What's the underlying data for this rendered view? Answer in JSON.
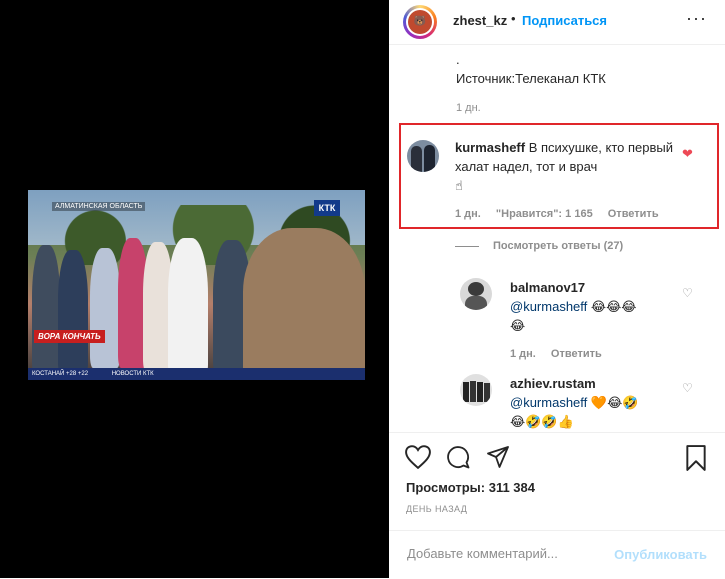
{
  "video": {
    "region_tag": "АЛМАТИНСКАЯ ОБЛАСТЬ",
    "channel_logo": "КТК",
    "caption": "ВОРА КОНЧАТЬ",
    "ticker_left": "КОСТАНАЙ +28 +22",
    "ticker_right": "НОВОСТИ КТК"
  },
  "header": {
    "username": "zhest_kz",
    "separator": "•",
    "follow": "Подписаться",
    "more": "···"
  },
  "caption": {
    "dot": ".",
    "source": "Источник:Телеканал КТК",
    "time": "1 дн."
  },
  "comments": [
    {
      "user": "kurmasheff",
      "text": "В психушке, кто первый халат надел, тот и врач",
      "emoji": "☝",
      "time": "1 дн.",
      "likes": "\"Нравится\": 1 165",
      "reply": "Ответить",
      "liked": true
    }
  ],
  "view_replies": "Посмотреть ответы (27)",
  "replies": [
    {
      "user": "balmanov17",
      "mention": "@kurmasheff",
      "emojis": "😂😂😂",
      "emoji_line2": "😂",
      "time": "1 дн.",
      "reply": "Ответить"
    },
    {
      "user": "azhiev.rustam",
      "mention": "@kurmasheff",
      "emojis": "🧡😂🤣",
      "emoji_line2": "😂🤣🤣👍"
    }
  ],
  "stats": {
    "views_label": "Просмотры:",
    "views_value": "311 384",
    "posted": "ДЕНЬ НАЗАД"
  },
  "add_comment": {
    "placeholder": "Добавьте комментарий...",
    "publish": "Опубликовать"
  },
  "colors": {
    "accent": "#0095f6",
    "highlight": "#e0262a",
    "like": "#ed4956"
  }
}
